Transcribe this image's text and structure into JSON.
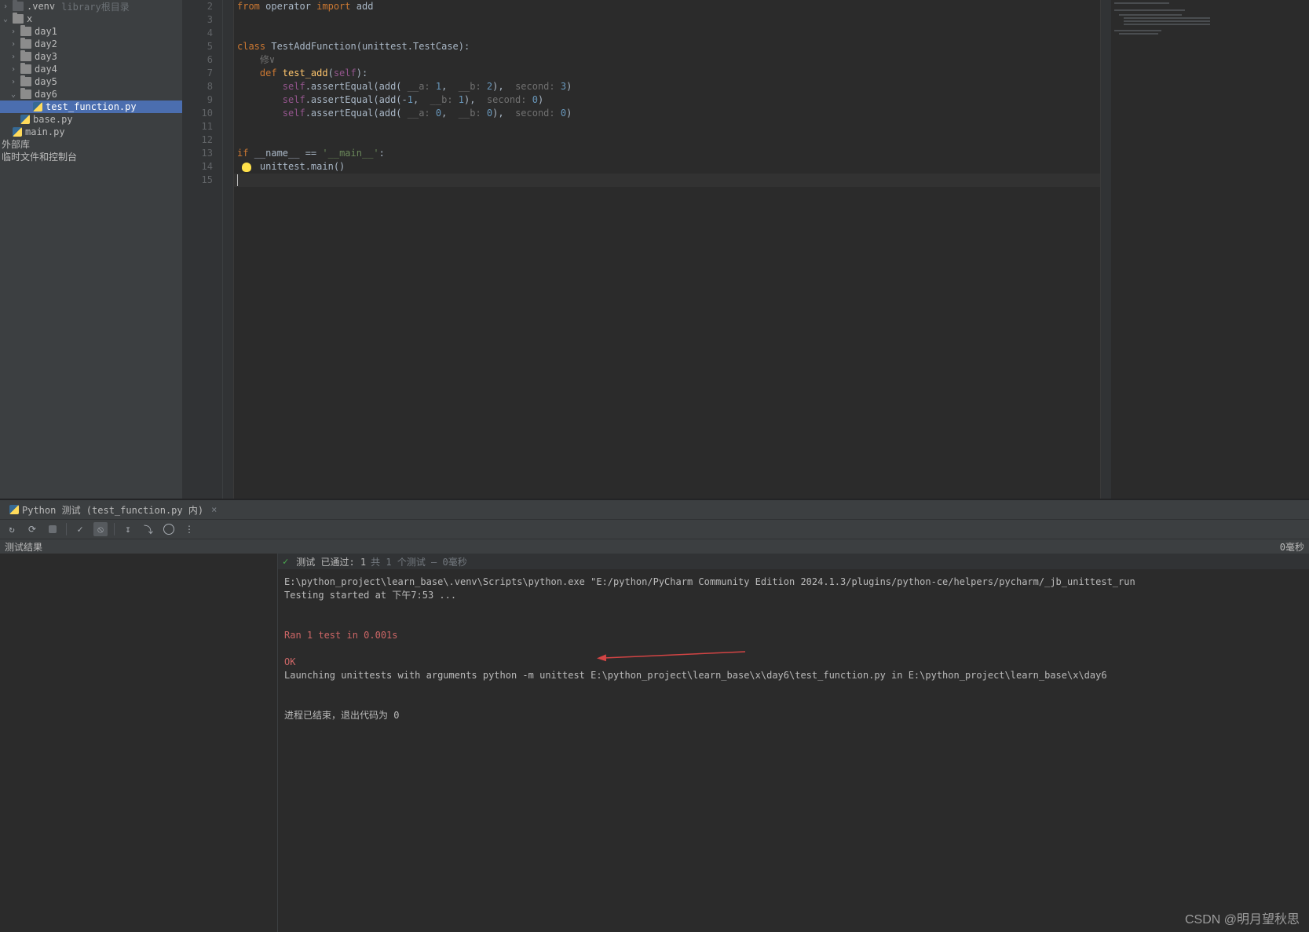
{
  "sidebar": {
    "items": [
      {
        "label": ".venv",
        "hint": "library根目录",
        "icon": "folder-dark",
        "indent": 0,
        "chev": "right"
      },
      {
        "label": "x",
        "icon": "folder",
        "indent": 0,
        "chev": "down"
      },
      {
        "label": "day1",
        "icon": "folder",
        "indent": 1,
        "chev": "right"
      },
      {
        "label": "day2",
        "icon": "folder",
        "indent": 1,
        "chev": "right"
      },
      {
        "label": "day3",
        "icon": "folder",
        "indent": 1,
        "chev": "right"
      },
      {
        "label": "day4",
        "icon": "folder",
        "indent": 1,
        "chev": "right"
      },
      {
        "label": "day5",
        "icon": "folder",
        "indent": 1,
        "chev": "right"
      },
      {
        "label": "day6",
        "icon": "folder",
        "indent": 1,
        "chev": "down"
      },
      {
        "label": "test_function.py",
        "icon": "py",
        "indent": 2,
        "chev": "none",
        "selected": true
      },
      {
        "label": "base.py",
        "icon": "py",
        "indent": 1,
        "chev": "none"
      },
      {
        "label": "main.py",
        "icon": "py",
        "indent": 0,
        "chev": "none"
      },
      {
        "label": "外部库",
        "icon": "none",
        "indent": 0,
        "chev": "none"
      },
      {
        "label": "临时文件和控制台",
        "icon": "none",
        "indent": 0,
        "chev": "none"
      }
    ]
  },
  "editor": {
    "line_numbers": [
      "2",
      "3",
      "4",
      "5",
      "6",
      "7",
      "8",
      "9",
      "10",
      "11",
      "12",
      "13",
      "14",
      "15"
    ],
    "run_markers_on": [
      5,
      7,
      13
    ],
    "caret_line": 15,
    "code_tokens": {
      "l2": {
        "k1": "from",
        "p1": " operator ",
        "k2": "import",
        "p2": " add"
      },
      "l5": {
        "k1": "class",
        "p1": " TestAddFunction(unittest.TestCase):"
      },
      "l7": {
        "k1": "    def ",
        "fn": "test_add",
        "p1": "(",
        "self": "self",
        "p2": "):"
      },
      "l8a": {
        "pre": "        ",
        "self": "self",
        "p1": ".assertEqual(add( ",
        "h1": "__a:",
        "n1": " 1",
        "c1": ",  ",
        "h2": "__b:",
        "n2": " 2",
        "p2": "),  ",
        "h3": "second:",
        "n3": " 3",
        "p3": ")"
      },
      "l9a": {
        "pre": "        ",
        "self": "self",
        "p1": ".assertEqual(add(-",
        "n1": "1",
        "c1": ",  ",
        "h2": "__b:",
        "n2": " 1",
        "p2": "),  ",
        "h3": "second:",
        "n3": " 0",
        "p3": ")"
      },
      "l10a": {
        "pre": "        ",
        "self": "self",
        "p1": ".assertEqual(add( ",
        "h1": "__a:",
        "n1": " 0",
        "c1": ",  ",
        "h2": "__b:",
        "n2": " 0",
        "p2": "),  ",
        "h3": "second:",
        "n3": " 0",
        "p3": ")"
      },
      "l13": {
        "k1": "if ",
        "p1": "__name__ == ",
        "s1": "'__main__'",
        "p2": ":"
      },
      "l14": {
        "p1": "    unittest.main()"
      }
    }
  },
  "run_panel": {
    "tab_label": "Python 测试 (test_function.py 内)",
    "results_label": "测试结果",
    "results_time": "0毫秒",
    "passed_prefix": "测试 已通过: 1",
    "passed_suffix": "共 1 个测试 – 0毫秒",
    "console": {
      "line1": "E:\\python_project\\learn_base\\.venv\\Scripts\\python.exe \"E:/python/PyCharm Community Edition 2024.1.3/plugins/python-ce/helpers/pycharm/_jb_unittest_run",
      "line2": "Testing started at 下午7:53 ...",
      "line3": "",
      "line4": "",
      "ran": "Ran 1 test in 0.001s",
      "blank": "",
      "ok": "OK",
      "launch": "Launching unittests with arguments python -m unittest E:\\python_project\\learn_base\\x\\day6\\test_function.py in E:\\python_project\\learn_base\\x\\day6",
      "exit": "进程已结束，退出代码为 0"
    }
  },
  "watermark": "CSDN @明月望秋思"
}
